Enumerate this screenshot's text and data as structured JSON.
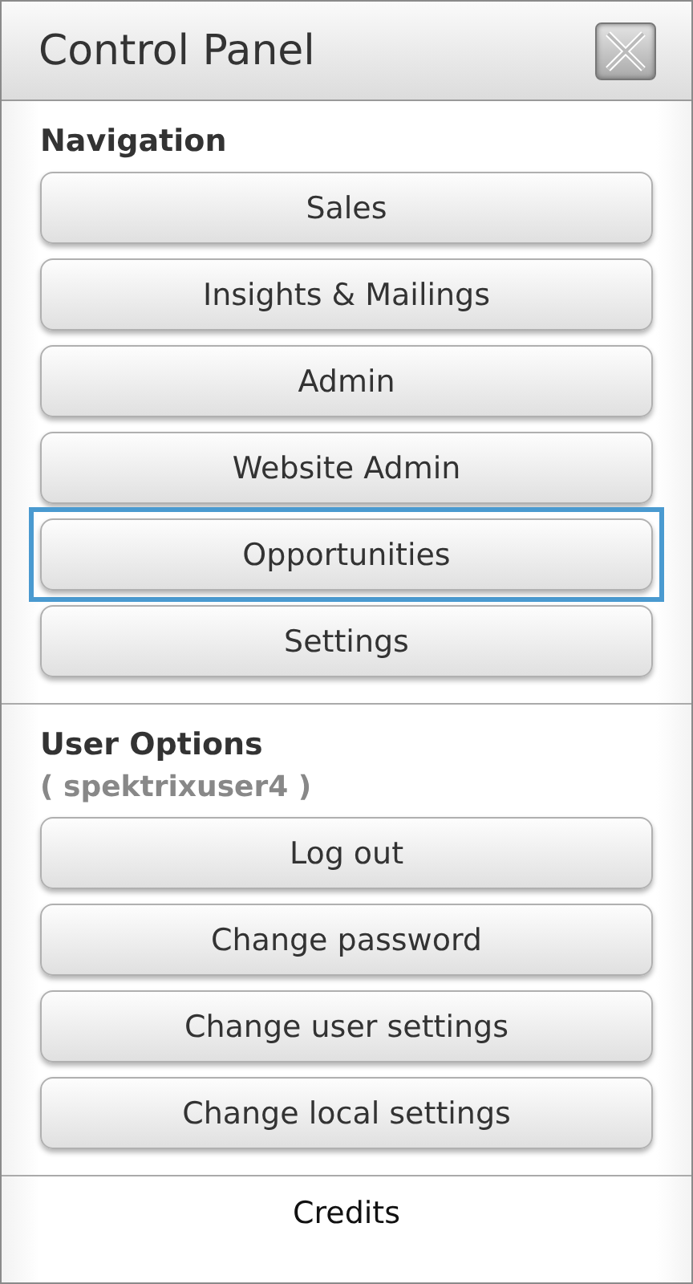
{
  "panel": {
    "title": "Control Panel"
  },
  "navigation": {
    "heading": "Navigation",
    "buttons": [
      {
        "label": "Sales",
        "focused": false
      },
      {
        "label": "Insights & Mailings",
        "focused": false
      },
      {
        "label": "Admin",
        "focused": false
      },
      {
        "label": "Website Admin",
        "focused": false
      },
      {
        "label": "Opportunities",
        "focused": true
      },
      {
        "label": "Settings",
        "focused": false
      }
    ]
  },
  "user_options": {
    "heading": "User Options",
    "username": "( spektrixuser4 )",
    "buttons": [
      {
        "label": "Log out",
        "focused": false
      },
      {
        "label": "Change password",
        "focused": false
      },
      {
        "label": "Change user settings",
        "focused": false
      },
      {
        "label": "Change local settings",
        "focused": false
      }
    ]
  },
  "footer": {
    "link": "Credits"
  }
}
